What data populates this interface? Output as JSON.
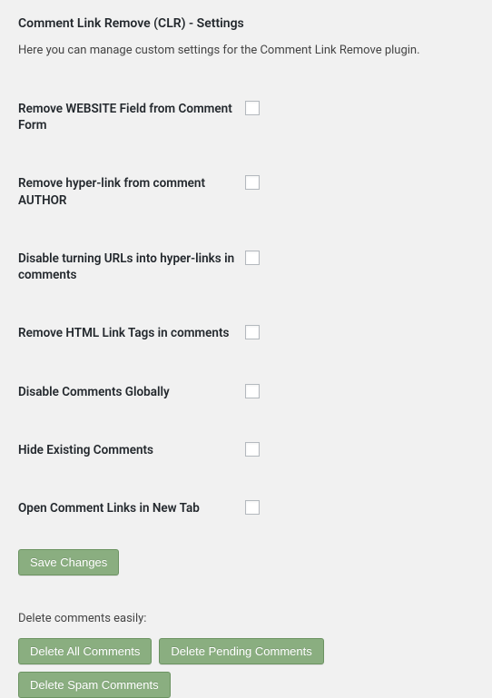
{
  "header": {
    "title": "Comment Link Remove (CLR) - Settings",
    "description": "Here you can manage custom settings for the Comment Link Remove plugin."
  },
  "settings": [
    {
      "label": "Remove WEBSITE Field from Comment Form",
      "checked": false
    },
    {
      "label": "Remove hyper-link from comment AUTHOR",
      "checked": false
    },
    {
      "label": "Disable turning URLs into hyper-links in comments",
      "checked": false
    },
    {
      "label": "Remove HTML Link Tags in comments",
      "checked": false
    },
    {
      "label": "Disable Comments Globally",
      "checked": false
    },
    {
      "label": "Hide Existing Comments",
      "checked": false
    },
    {
      "label": "Open Comment Links in New Tab",
      "checked": false
    }
  ],
  "actions": {
    "save_label": "Save Changes",
    "delete_label": "Delete comments easily:",
    "delete_all": "Delete All Comments",
    "delete_pending": "Delete Pending Comments",
    "delete_spam": "Delete Spam Comments"
  }
}
